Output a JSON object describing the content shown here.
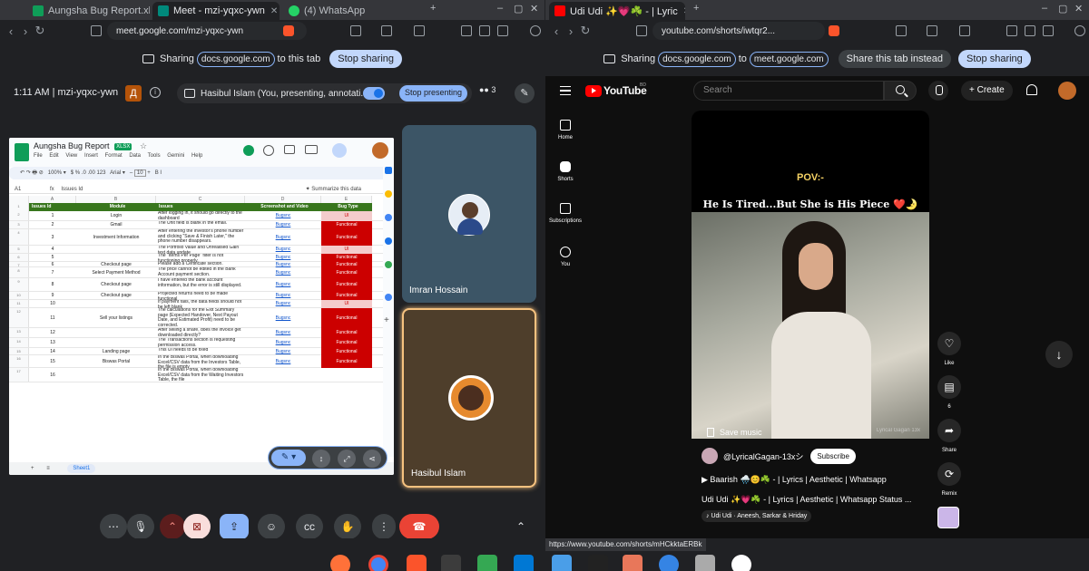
{
  "left_window": {
    "tabs": [
      {
        "label": "Aungsha Bug Report.xlsx",
        "active": false
      },
      {
        "label": "Meet - mzi-yqxc-ywn",
        "active": true
      },
      {
        "label": "(4) WhatsApp",
        "active": false
      }
    ],
    "url": "meet.google.com/mzi-yqxc-ywn",
    "sharing": {
      "prefix": "Sharing",
      "site": "docs.google.com",
      "suffix": "to this tab",
      "stop_label": "Stop sharing"
    },
    "meet": {
      "time_code": "1:11 AM | mzi-yqxc-ywn",
      "presenting_text": "Hasibul Islam (You, presenting, annotati...",
      "stop_presenting_label": "Stop presenting",
      "people_count": "3",
      "participants": [
        {
          "name": "Imran Hossain"
        },
        {
          "name": "Hasibul Islam"
        }
      ]
    },
    "sheet": {
      "title": "Aungsha Bug Report",
      "badge": "XLSX",
      "menu": [
        "File",
        "Edit",
        "View",
        "Insert",
        "Format",
        "Data",
        "Tools",
        "Gemini",
        "Help"
      ],
      "zoom": "100%",
      "font": "Arial",
      "font_size": "10",
      "cell_ref": "A1",
      "formula": "Issues Id",
      "summarize": "Summarize this data",
      "columns": [
        "A",
        "B",
        "C",
        "D",
        "E"
      ],
      "headers": [
        "Issues Id",
        "Module",
        "Issues",
        "Screenshot and Video",
        "Bug Type"
      ],
      "rows": [
        {
          "rn": "2",
          "id": "1",
          "module": "Login",
          "issue": "After logging in, it should go directly to the dashboard",
          "shot": "Bugsnc",
          "type": "UI"
        },
        {
          "rn": "3",
          "id": "2",
          "module": "Gmail",
          "issue": "The Unit field is blank in the email.",
          "shot": "Bugsnc",
          "type": "Functional"
        },
        {
          "rn": "4",
          "id": "3",
          "module": "Investment Information",
          "issue": "After entering the investor's phone number and clicking \"Save & Finish Later,\" the phone number disappears.",
          "shot": "Bugsnc",
          "type": "Functional"
        },
        {
          "rn": "5",
          "id": "4",
          "module": "",
          "issue": "The Portfolio Value and Unrealised Gain text data update",
          "shot": "Bugsnc",
          "type": "UI"
        },
        {
          "rn": "6",
          "id": "5",
          "module": "",
          "issue": "The \"Items Per Page\" filter is not functioning properly.",
          "shot": "Bugsnc",
          "type": "Functional"
        },
        {
          "rn": "7",
          "id": "6",
          "module": "Checkout page",
          "issue": "Please add a Certificate section.",
          "shot": "Bugsnc",
          "type": "Functional"
        },
        {
          "rn": "8",
          "id": "7",
          "module": "Select Payment Method",
          "issue": "The price cannot be edited in the Bank Account payment section.",
          "shot": "Bugsnc",
          "type": "Functional"
        },
        {
          "rn": "9",
          "id": "8",
          "module": "Checkout page",
          "issue": "I have entered the bank account information, but the error is still displayed.",
          "shot": "Bugsnc",
          "type": "Functional"
        },
        {
          "rn": "10",
          "id": "9",
          "module": "Checkout page",
          "issue": "Projected returns need to be made functional",
          "shot": "Bugsnc",
          "type": "Functional"
        },
        {
          "rn": "11",
          "id": "10",
          "module": "",
          "issue": "If payment fails, the data fields should not be left blank",
          "shot": "Bugsnc",
          "type": "UI"
        },
        {
          "rn": "12",
          "id": "11",
          "module": "Sell your listings",
          "issue": "The calculations for the Exit Summary page (Expected Handover, Next Payout Date, and Estimated Profit) need to be corrected.",
          "shot": "Bugsnc",
          "type": "Functional"
        },
        {
          "rn": "13",
          "id": "12",
          "module": "",
          "issue": "After selling a share, does the invoice get downloaded directly?",
          "shot": "Bugsnc",
          "type": "Functional"
        },
        {
          "rn": "14",
          "id": "13",
          "module": "",
          "issue": "The Transactions section is requesting permission access.",
          "shot": "Bugsnc",
          "type": "Functional"
        },
        {
          "rn": "15",
          "id": "14",
          "module": "Landing page",
          "issue": "This UI needs to be fixed",
          "shot": "Bugsnc",
          "type": "Functional"
        },
        {
          "rn": "16",
          "id": "15",
          "module": "Biswas Portal",
          "issue": "In the Biswas Portal, when downloading Excel/CSV data from the Investors Table, the file is empty",
          "shot": "Bugsnc",
          "type": "Functional"
        },
        {
          "rn": "17",
          "id": "16",
          "module": "",
          "issue": "In the Biswas Portal, when downloading Excel/CSV data from the Waiting Investors Table, the file",
          "shot": "",
          "type": ""
        }
      ],
      "sheet_tab": "Sheet1"
    }
  },
  "right_window": {
    "tab_label": "Udi Udi ✨💗☘️ - | Lyric",
    "url": "youtube.com/shorts/iwtqr2...",
    "sharing": {
      "prefix": "Sharing",
      "site": "docs.google.com",
      "middle": "to",
      "target": "meet.google.com",
      "share_tab_label": "Share this tab instead",
      "stop_label": "Stop sharing"
    },
    "youtube": {
      "logo": "YouTube",
      "country": "BD",
      "search_placeholder": "Search",
      "create_label": "Create",
      "side": [
        {
          "label": "Home"
        },
        {
          "label": "Shorts"
        },
        {
          "label": "Subscriptions"
        },
        {
          "label": "You"
        }
      ],
      "short": {
        "overlay_pov": "POV:-",
        "overlay_tag": "He Is Tired...But She is His Piece ❤️🌛",
        "watermark": "Lyrical Gagan 13x",
        "save_music": "Save music",
        "channel": "@LyricalGagan-13xシ",
        "subscribe": "Subscribe",
        "song_line": "▶ Baarish 🌧️😊☘️ - | Lyrics | Aesthetic | Whatsapp",
        "title": "Udi Udi ✨💗☘️ - | Lyrics | Aesthetic | Whatsapp Status ...",
        "music_chip": "♪ Udi Udi · Aneesh, Sarkar & Hriday"
      },
      "actions": [
        {
          "label": "Like"
        },
        {
          "label": "6"
        },
        {
          "label": "Share"
        },
        {
          "label": "Remix"
        }
      ]
    },
    "status_url": "https://www.youtube.com/shorts/mHCkktaERBk"
  }
}
